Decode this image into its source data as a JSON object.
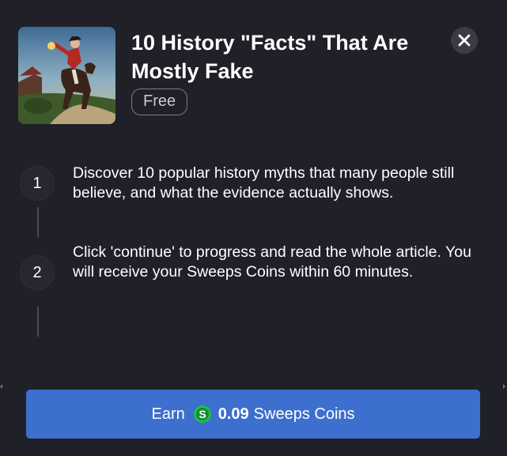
{
  "offer": {
    "title": "10 History \"Facts\" That Are Mostly Fake",
    "price_badge": "Free",
    "thumbnail": "rider-on-horse-painting"
  },
  "close": {
    "icon": "close-icon"
  },
  "steps": [
    {
      "number": "1",
      "text": "Discover 10 popular history myths that many people still believe, and what the evidence actually shows."
    },
    {
      "number": "2",
      "text": "Click 'continue' to progress and read the whole article. You will receive your Sweeps Coins within 60 minutes."
    }
  ],
  "cta": {
    "prefix": "Earn",
    "coin_icon": "sweeps-coin-icon",
    "amount": "0.09",
    "suffix": "Sweeps Coins"
  },
  "colors": {
    "background": "#1f2028",
    "button": "#3d6fce",
    "coin": "#1fbf4a"
  }
}
